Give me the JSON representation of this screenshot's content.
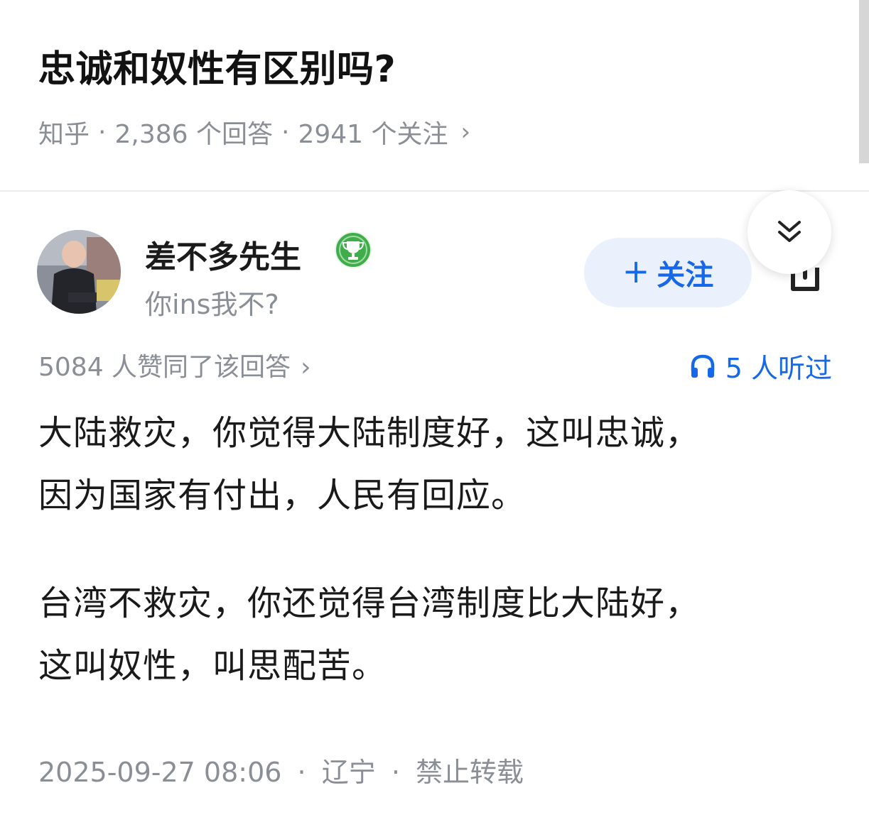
{
  "question": {
    "title": "忠诚和奴性有区别吗?",
    "site": "知乎",
    "answers": "2,386 个回答",
    "followers": "2941 个关注",
    "more_icon": "chevron-right-icon"
  },
  "author": {
    "name": "差不多先生",
    "badge_icon": "trophy-badge-icon",
    "bio": "你ins我不?",
    "follow_label": "关注",
    "follow_icon": "plus-icon"
  },
  "controls": {
    "collapse_icon": "double-chevron-down-icon",
    "share_icon": "share-icon"
  },
  "answer": {
    "upvotes": "5084 人赞同了该回答",
    "listen_count": "5 人听过",
    "listen_icon": "headphones-icon",
    "paragraphs": [
      [
        "大陆救灾，你觉得大陆制度好，这叫忠诚，",
        "因为国家有付出，人民有回应。"
      ],
      [
        "台湾不救灾，你还觉得台湾制度比大陆好，",
        "这叫奴性，叫思配苦。"
      ]
    ],
    "timestamp": "2025-09-27 08:06",
    "location": "辽宁",
    "rights": "禁止转载"
  },
  "colors": {
    "accent": "#1668e8",
    "muted": "#8a8e95",
    "text": "#1a1a1a",
    "follow_bg": "#eaf1fd",
    "badge": "#3fae4a"
  }
}
